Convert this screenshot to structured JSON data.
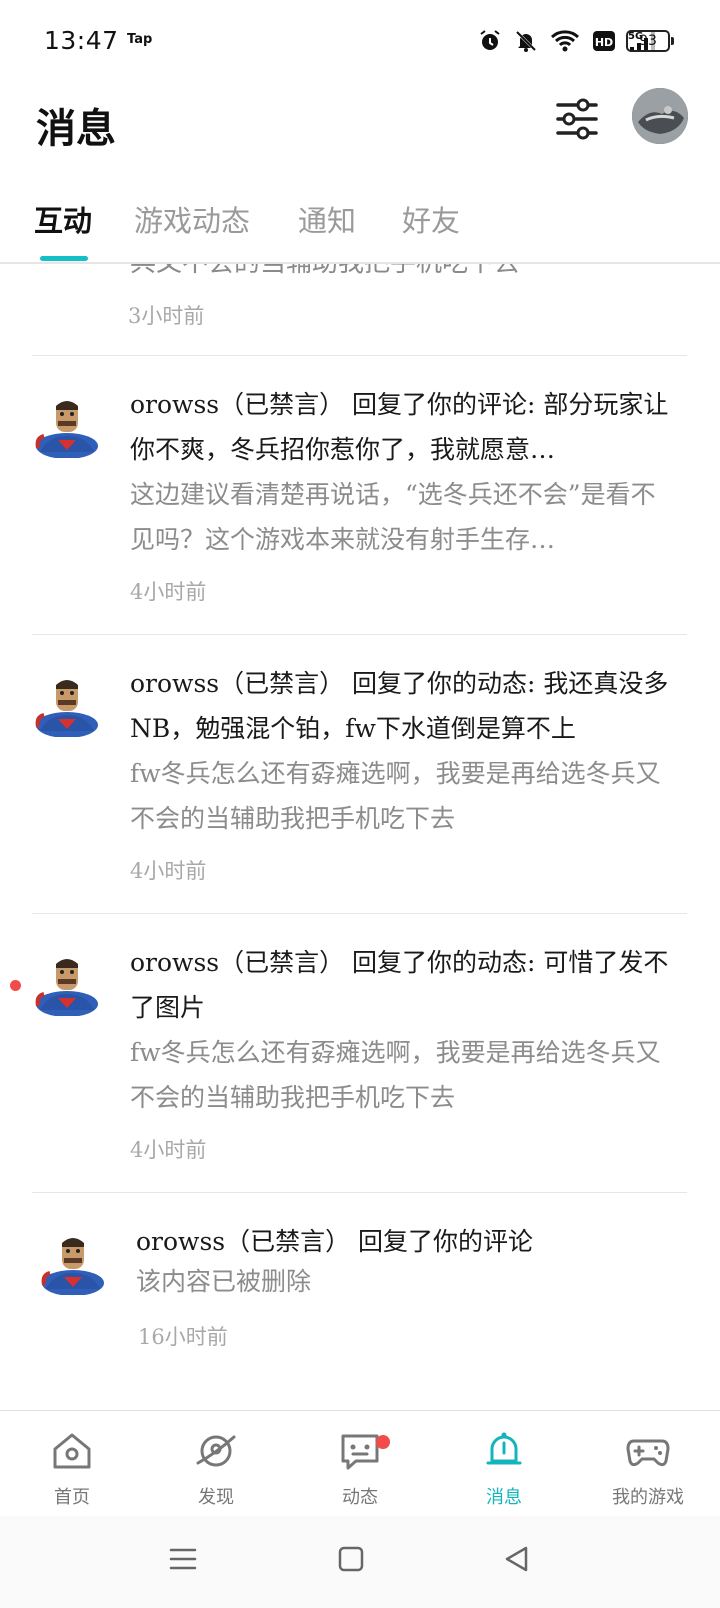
{
  "status_bar": {
    "time": "13:47",
    "app_tag": "Tap",
    "battery": "93",
    "network": "5G",
    "hd": "HD"
  },
  "header": {
    "title": "消息"
  },
  "tabs": [
    {
      "label": "互动",
      "active": true
    },
    {
      "label": "游戏动态",
      "active": false
    },
    {
      "label": "通知",
      "active": false
    },
    {
      "label": "好友",
      "active": false
    }
  ],
  "partial_item": {
    "quote_tail": "兵又不会的当辅助我把手机吃下去",
    "time": "3小时前"
  },
  "messages": [
    {
      "title": "orowss（已禁言） 回复了你的评论: 部分玩家让你不爽，冬兵招你惹你了，我就愿意…",
      "quote": "这边建议看清楚再说话，“选冬兵还不会”是看不见吗？这个游戏本来就没有射手生存…",
      "time": "4小时前",
      "unread": false
    },
    {
      "title": "orowss（已禁言） 回复了你的动态: 我还真没多NB，勉强混个铂，fw下水道倒是算不上",
      "quote": "fw冬兵怎么还有孬瘫选啊，我要是再给选冬兵又不会的当辅助我把手机吃下去",
      "time": "4小时前",
      "unread": false
    },
    {
      "title": "orowss（已禁言） 回复了你的动态: 可惜了发不了图片",
      "quote": "fw冬兵怎么还有孬瘫选啊，我要是再给选冬兵又不会的当辅助我把手机吃下去",
      "time": "4小时前",
      "unread": true
    },
    {
      "title": "orowss（已禁言） 回复了你的评论",
      "quote": "该内容已被删除",
      "time": "16小时前",
      "unread": false
    }
  ],
  "bottom_nav": [
    {
      "label": "首页",
      "icon": "home-icon",
      "active": false
    },
    {
      "label": "发现",
      "icon": "discover-planet-icon",
      "active": false
    },
    {
      "label": "动态",
      "icon": "chat-feed-icon",
      "active": false,
      "badge": true
    },
    {
      "label": "消息",
      "icon": "bell-icon",
      "active": true
    },
    {
      "label": "我的游戏",
      "icon": "gamepad-icon",
      "active": false
    }
  ],
  "colors": {
    "accent": "#14C0C8",
    "badge": "#F24B4B",
    "secondary_text": "#8C8C8C"
  }
}
